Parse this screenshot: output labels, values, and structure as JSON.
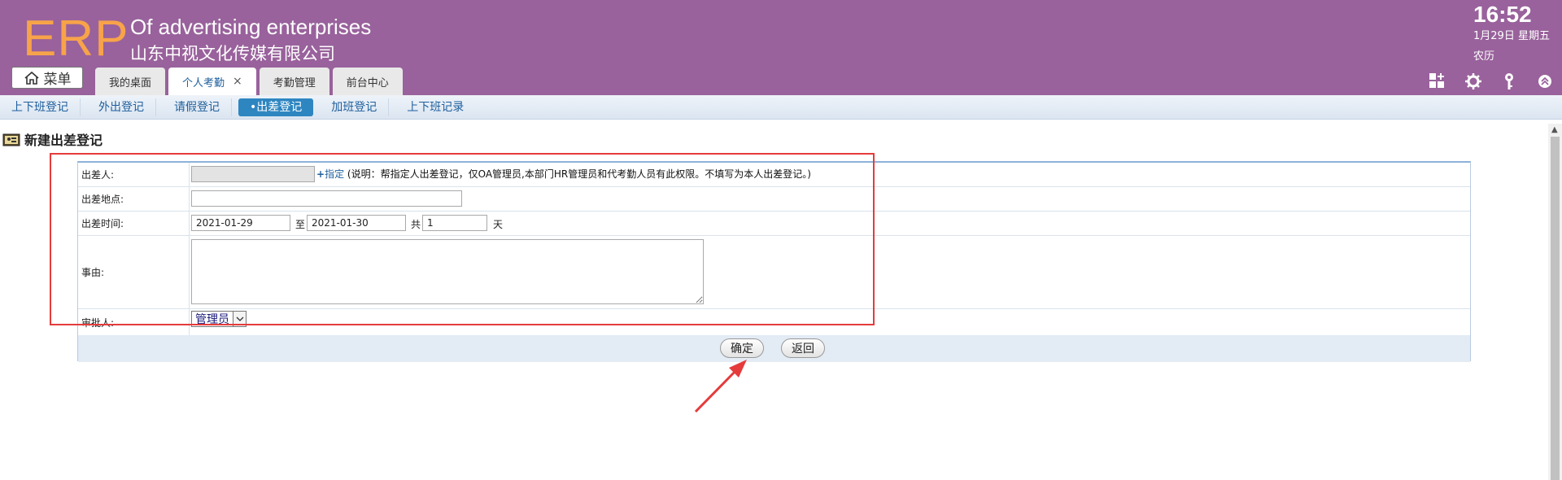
{
  "header": {
    "logo": "ERP",
    "company_en": "Of advertising enterprises",
    "company_cn": "山东中视文化传媒有限公司",
    "time": "16:52",
    "date": "1月29日 星期五",
    "lunar": "农历",
    "menu_label": "菜单",
    "tabs": [
      {
        "label": "我的桌面"
      },
      {
        "label": "个人考勤"
      },
      {
        "label": "考勤管理"
      },
      {
        "label": "前台中心"
      }
    ],
    "close_glyph": "×",
    "icons": [
      "add-widget-icon",
      "gear-icon",
      "key-icon",
      "collapse-up-icon"
    ]
  },
  "subnav": {
    "items": [
      {
        "label": "上下班登记"
      },
      {
        "label": "外出登记"
      },
      {
        "label": "请假登记"
      },
      {
        "label": "•出差登记"
      },
      {
        "label": "加班登记"
      },
      {
        "label": "上下班记录"
      }
    ]
  },
  "page": {
    "title": "新建出差登记"
  },
  "form": {
    "traveler_label": "出差人:",
    "traveler_value": "",
    "assign_plus": "+",
    "assign_link": "指定",
    "assign_note": "(说明：帮指定人出差登记，仅OA管理员,本部门HR管理员和代考勤人员有此权限。不填写为本人出差登记。)",
    "place_label": "出差地点:",
    "place_value": "",
    "time_label": "出差时间:",
    "start_date": "2021-01-29",
    "to_text": "至",
    "end_date": "2021-01-30",
    "total_text": "共",
    "days_value": "1",
    "days_unit": "天",
    "reason_label": "事由:",
    "reason_value": "",
    "approver_label": "审批人:",
    "approver_value": "管理员",
    "confirm_label": "确定",
    "back_label": "返回"
  },
  "colors": {
    "header_bg": "#99629c",
    "logo": "#f7a34a",
    "active_sub": "#2e86c1",
    "annotation": "#e53b3b"
  }
}
